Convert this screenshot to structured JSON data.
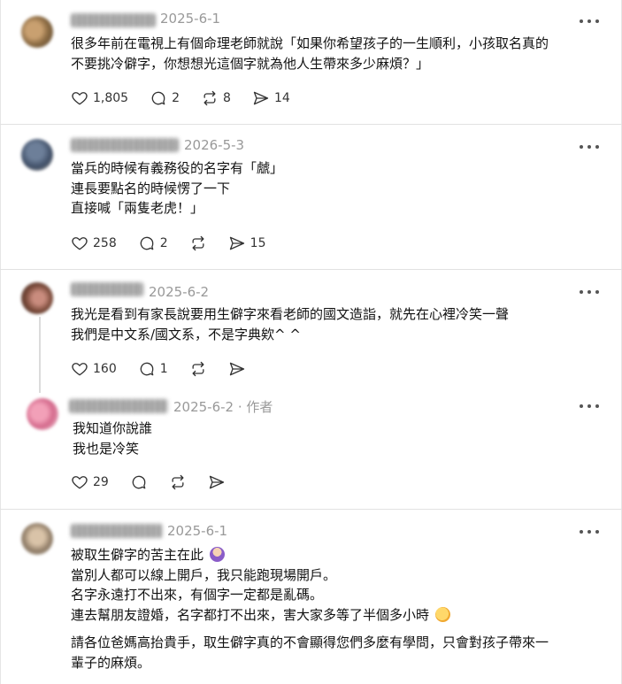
{
  "posts": [
    {
      "date": "2025-6-1",
      "lines": [
        "很多年前在電視上有個命理老師就說「如果你希望孩子的一生順利，小孩取名真的",
        "不要挑冷僻字，你想想光這個字就為他人生帶來多少麻煩？」"
      ],
      "likes": "1,805",
      "replies": "2",
      "reposts": "8",
      "shares": "14"
    },
    {
      "date": "2026-5-3",
      "lines": [
        "當兵的時候有義務役的名字有「虤」",
        "連長要點名的時候愣了一下",
        "直接喊「兩隻老虎！」"
      ],
      "likes": "258",
      "replies": "2",
      "reposts": "",
      "shares": "15"
    },
    {
      "date": "2025-6-2",
      "lines": [
        "我光是看到有家長說要用生僻字來看老師的國文造詣，就先在心裡冷笑一聲",
        "我們是中文系/國文系，不是字典欸^ ^"
      ],
      "likes": "160",
      "replies": "1",
      "reposts": "",
      "shares": ""
    },
    {
      "date": "2025-6-2",
      "author_tag": "· 作者",
      "lines": [
        "我知道你說誰",
        "我也是冷笑"
      ],
      "likes": "29",
      "replies": "",
      "reposts": "",
      "shares": ""
    },
    {
      "date": "2025-6-1",
      "lines": [
        "被取生僻字的苦主在此",
        "當別人都可以線上開戶，我只能跑現場開戶。",
        "名字永遠打不出來，有個字一定都是亂碼。",
        "連去幫朋友證婚，名字都打不出來，害大家多等了半個多小時"
      ],
      "paragraph2": [
        "請各位爸媽高抬貴手，取生僻字真的不會顯得您們多麼有學問，只會對孩子帶來一",
        "輩子的麻煩。"
      ],
      "likes": "",
      "replies": "",
      "reposts": "",
      "shares": ""
    }
  ],
  "icons": {
    "like": "heart-icon",
    "reply": "comment-icon",
    "repost": "repost-icon",
    "share": "share-icon",
    "more": "more-icon"
  },
  "colors": {
    "text": "#111111",
    "meta": "#999999",
    "icon": "#333333",
    "divider": "#e2e2e2"
  }
}
